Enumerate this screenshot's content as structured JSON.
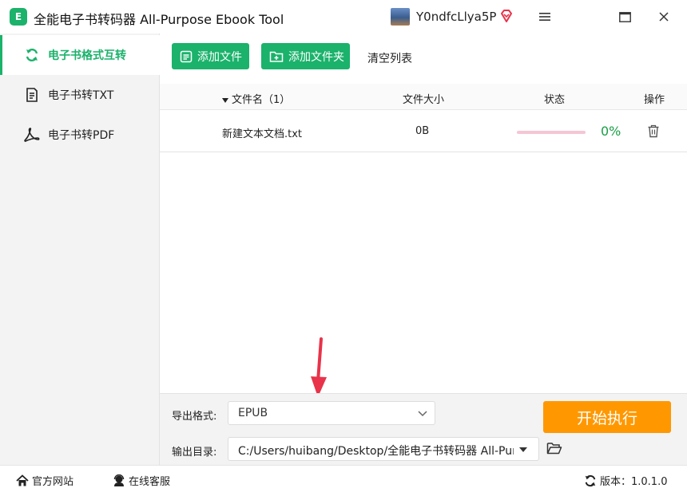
{
  "app": {
    "logo_text": "E",
    "title": "全能电子书转码器 All-Purpose Ebook Tool",
    "user_name": "Y0ndfcLlya5P"
  },
  "sidebar": {
    "items": [
      {
        "label": "电子书格式互转",
        "icon": "refresh-icon",
        "active": true
      },
      {
        "label": "电子书转TXT",
        "icon": "document-icon",
        "active": false
      },
      {
        "label": "电子书转PDF",
        "icon": "pdf-icon",
        "active": false
      }
    ]
  },
  "toolbar": {
    "add_file": "添加文件",
    "add_folder": "添加文件夹",
    "clear_list": "清空列表"
  },
  "table": {
    "headers": {
      "name": "文件名（1）",
      "size": "文件大小",
      "status": "状态",
      "action": "操作"
    },
    "rows": [
      {
        "name": "新建文本文档.txt",
        "size": "0B",
        "progress": 0,
        "percent": "0%"
      }
    ]
  },
  "bottom": {
    "format_label": "导出格式:",
    "format_value": "EPUB",
    "outdir_label": "输出目录:",
    "outdir_value": "C:/Users/huibang/Desktop/全能电子书转码器 All-Purpose Ebook Tool",
    "start_label": "开始执行"
  },
  "footer": {
    "website": "官方网站",
    "service": "在线客服",
    "version": "版本：1.0.1.0"
  },
  "colors": {
    "accent": "#1bb26b",
    "start": "#ff9800",
    "progress_track": "#f4c6d4",
    "percent": "#1a9e45",
    "arrow": "#e8334a"
  }
}
